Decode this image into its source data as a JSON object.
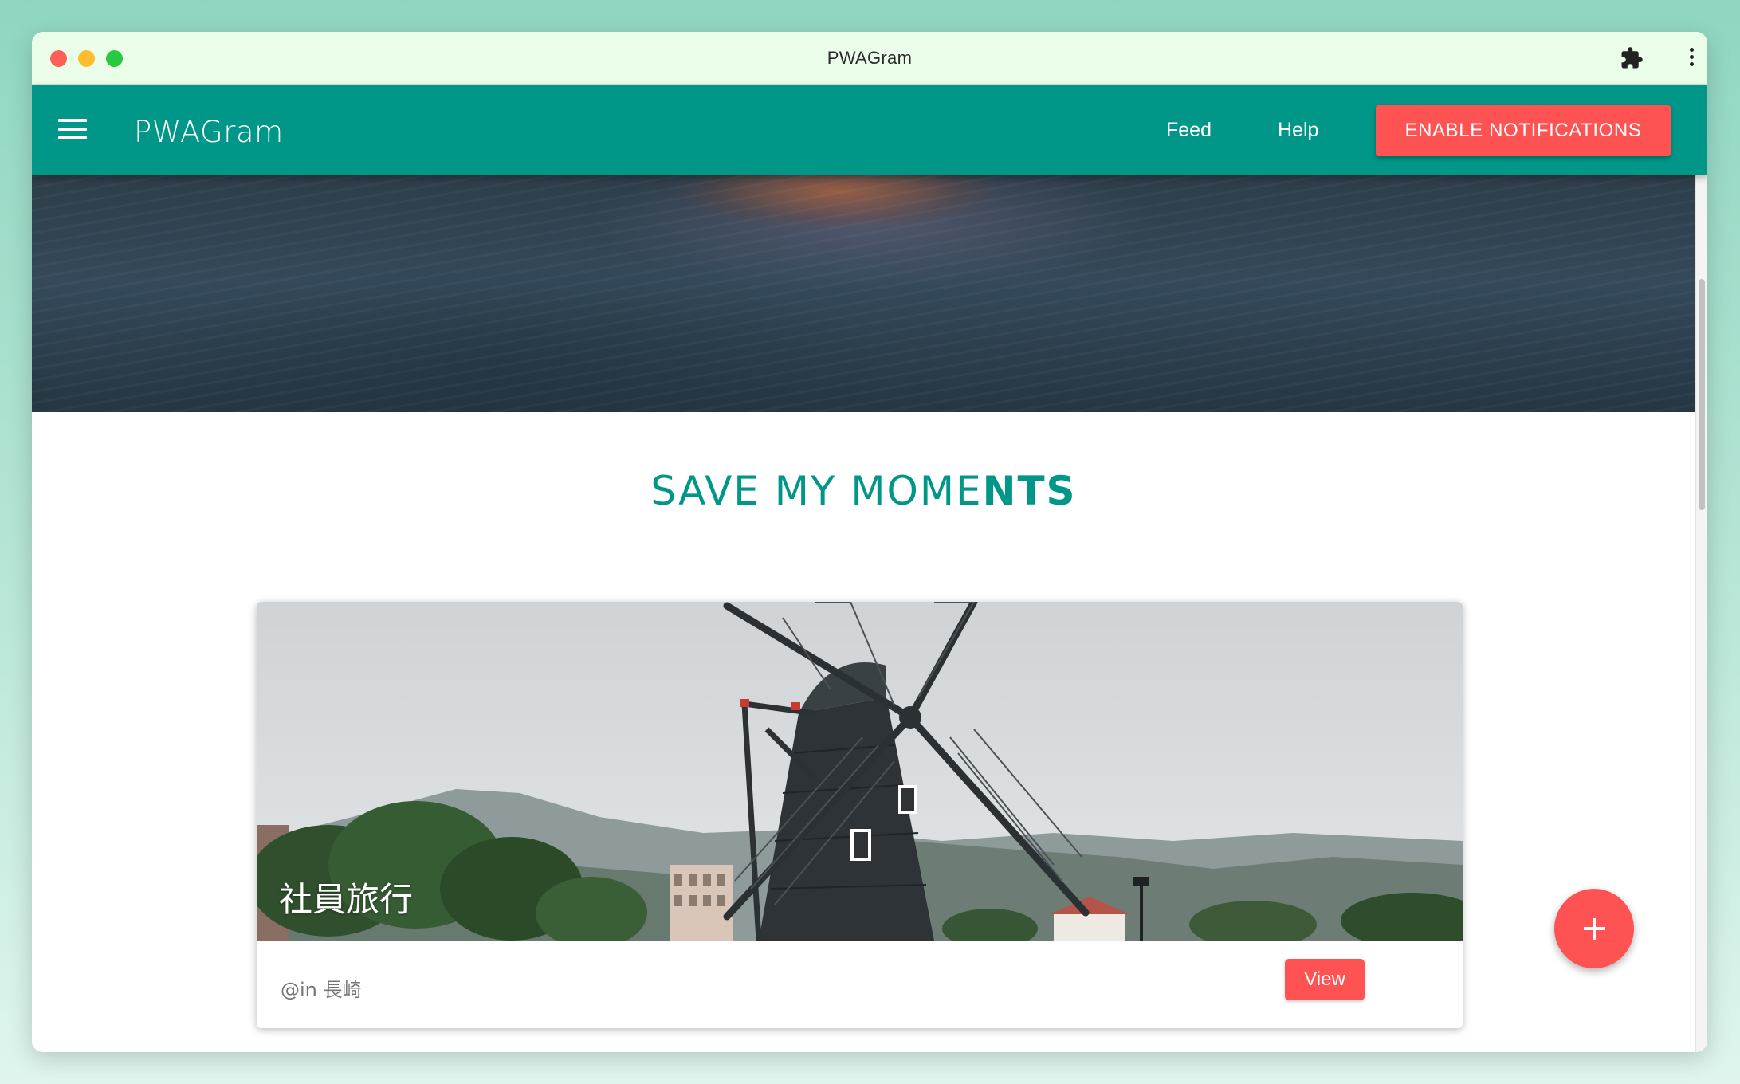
{
  "window": {
    "title": "PWAGram"
  },
  "appbar": {
    "title": "PWAGram",
    "nav": [
      "Feed",
      "Help"
    ],
    "notify_label": "ENABLE NOTIFICATIONS"
  },
  "page": {
    "headline_a": "SAVE MY MOME",
    "headline_b": "NTS"
  },
  "card": {
    "title": "社員旅行",
    "location": "@in 長崎",
    "view_label": "View"
  },
  "icons": {
    "menu": "menu-icon",
    "extensions": "puzzle-icon",
    "more": "kebab-icon",
    "fab": "plus-icon"
  },
  "colors": {
    "primary": "#009688",
    "accent": "#ff5252",
    "titlebar": "#eafde9"
  }
}
